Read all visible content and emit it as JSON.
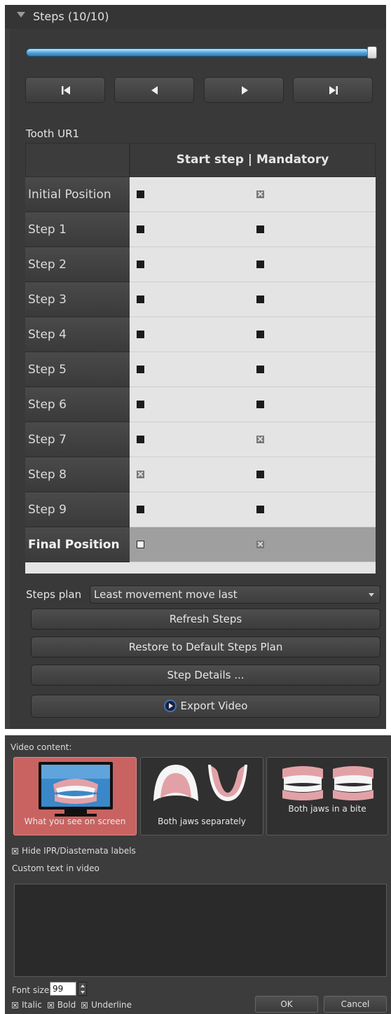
{
  "steps_panel": {
    "title": "Steps (10/10)",
    "progress_fraction": 1.0,
    "tooth_label": "Tooth UR1",
    "table_header": "Start step | Mandatory",
    "rows": [
      {
        "label": "Initial Position"
      },
      {
        "label": "Step 1"
      },
      {
        "label": "Step 2"
      },
      {
        "label": "Step 3"
      },
      {
        "label": "Step 4"
      },
      {
        "label": "Step 5"
      },
      {
        "label": "Step 6"
      },
      {
        "label": "Step 7"
      },
      {
        "label": "Step 8"
      },
      {
        "label": "Step 9"
      },
      {
        "label": "Final Position"
      }
    ],
    "steps_plan_label": "Steps plan",
    "steps_plan_value": "Least movement move last",
    "refresh_label": "Refresh Steps",
    "restore_label": "Restore to Default Steps Plan",
    "details_label": "Step Details ...",
    "export_label": "Export Video"
  },
  "video_dialog": {
    "content_label": "Video content:",
    "options": [
      {
        "label": "What you see on screen",
        "selected": true
      },
      {
        "label": "Both jaws separately",
        "selected": false
      },
      {
        "label": "Both jaws in a bite",
        "selected": false
      }
    ],
    "hide_ipr_label": "Hide IPR/Diastemata labels",
    "custom_text_label": "Custom text in video",
    "font_size_label": "Font size",
    "font_size_value": "99",
    "italic_label": "Italic",
    "bold_label": "Bold",
    "underline_label": "Underline",
    "ok_label": "OK",
    "cancel_label": "Cancel"
  },
  "colors": {
    "panel_bg": "#393939",
    "selected_option": "#c86361",
    "slider_blue": "#4ea0d7"
  }
}
